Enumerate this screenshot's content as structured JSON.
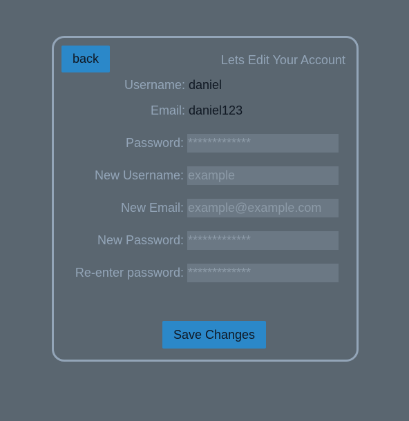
{
  "header": {
    "back_label": "back",
    "title": "Lets Edit Your Account"
  },
  "account": {
    "username_label": "Username:",
    "username_value": "daniel",
    "email_label": "Email:",
    "email_value": "daniel123"
  },
  "form": {
    "password_label": "Password:",
    "password_placeholder": "*************",
    "new_username_label": "New Username:",
    "new_username_placeholder": "example",
    "new_email_label": "New Email:",
    "new_email_placeholder": "example@example.com",
    "new_password_label": "New Password:",
    "new_password_placeholder": "*************",
    "reenter_password_label": "Re-enter password:",
    "reenter_password_placeholder": "*************"
  },
  "actions": {
    "save_label": "Save Changes"
  },
  "colors": {
    "background": "#5a6670",
    "accent": "#2b88c9",
    "muted_text": "#93a5b8",
    "input_bg": "#6b7884"
  }
}
